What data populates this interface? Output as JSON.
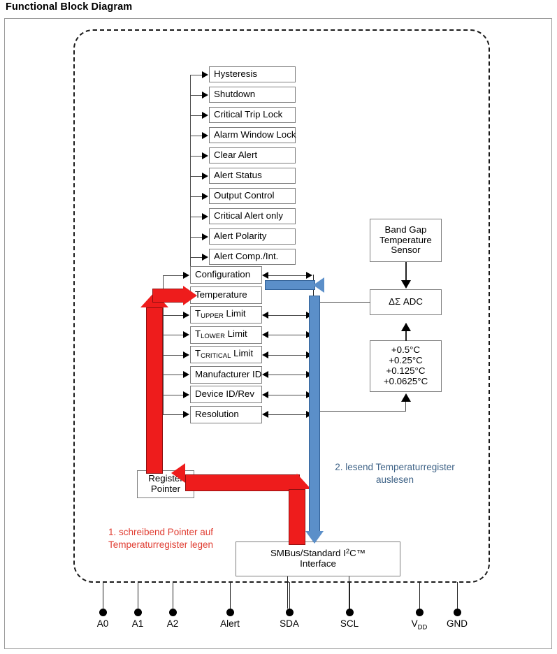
{
  "page_title": "Functional Block Diagram",
  "config_items": [
    {
      "label": "Hysteresis"
    },
    {
      "label": "Shutdown"
    },
    {
      "label": "Critical Trip Lock"
    },
    {
      "label": "Alarm Window Lock"
    },
    {
      "label": "Clear Alert"
    },
    {
      "label": "Alert Status"
    },
    {
      "label": "Output Control"
    },
    {
      "label": "Critical Alert only"
    },
    {
      "label": "Alert Polarity"
    },
    {
      "label": "Alert Comp./Int."
    }
  ],
  "registers": [
    {
      "label": "Configuration"
    },
    {
      "label": "Temperature"
    },
    {
      "label": "T",
      "sub": "UPPER",
      "tail": " Limit"
    },
    {
      "label": "T",
      "sub": "LOWER",
      "tail": " Limit"
    },
    {
      "label": "T",
      "sub": "CRITICAL",
      "tail": " Limit"
    },
    {
      "label": "Manufacturer ID"
    },
    {
      "label": "Device ID/Rev"
    },
    {
      "label": "Resolution"
    }
  ],
  "blocks": {
    "band_gap": {
      "line1": "Band Gap",
      "line2": "Temperature",
      "line3": "Sensor"
    },
    "adc": {
      "label": "ΔΣ ADC"
    },
    "resolution_values": [
      "+0.5°C",
      "+0.25°C",
      "+0.125°C",
      "+0.0625°C"
    ],
    "register_pointer": {
      "line1": "Register",
      "line2": "Pointer"
    },
    "interface": {
      "prefix": "SMBus/Standard I",
      "sup": "2",
      "suffix": "C™",
      "line2": "Interface"
    }
  },
  "annotations": {
    "step1": "1. schreibend Pointer auf\nTemperaturregister legen",
    "step2": "2. lesend Temperaturregister\nauslesen"
  },
  "pins": [
    {
      "label": "A0",
      "sub": ""
    },
    {
      "label": "A1",
      "sub": ""
    },
    {
      "label": "A2",
      "sub": ""
    },
    {
      "label": "Alert",
      "sub": ""
    },
    {
      "label": "SDA",
      "sub": ""
    },
    {
      "label": "SCL",
      "sub": ""
    },
    {
      "label": "V",
      "sub": "DD"
    },
    {
      "label": "GND",
      "sub": ""
    }
  ],
  "colors": {
    "write_flow": "#ee1c1c",
    "read_flow": "#5b8fc9",
    "frame": "#9b9b9b",
    "chip_boundary": "#1a1a1a"
  }
}
